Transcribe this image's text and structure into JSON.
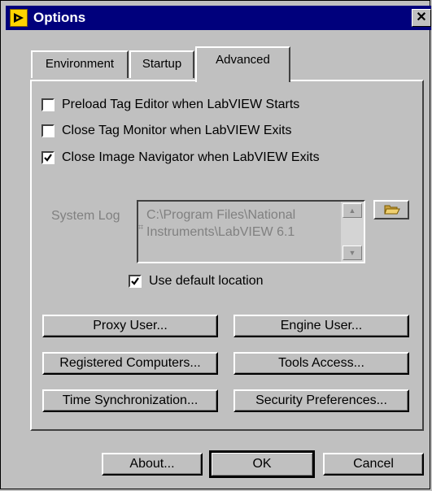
{
  "window": {
    "title": "Options",
    "close_glyph": "✕"
  },
  "tabs": [
    {
      "label": "Environment",
      "active": false
    },
    {
      "label": "Startup",
      "active": false
    },
    {
      "label": "Advanced",
      "active": true
    }
  ],
  "advanced": {
    "options": [
      {
        "label": "Preload Tag Editor when LabVIEW Starts",
        "checked": false
      },
      {
        "label": "Close Tag Monitor when LabVIEW Exits",
        "checked": false
      },
      {
        "label": "Close Image Navigator when LabVIEW Exits",
        "checked": true
      }
    ],
    "system_log": {
      "label": "System Log",
      "path_line1": "C:\\Program Files\\National",
      "path_line2": "Instruments\\LabVIEW 6.1",
      "enabled": false
    },
    "use_default_location": {
      "label": "Use default location",
      "checked": true
    },
    "buttons": {
      "proxy_user": "Proxy User...",
      "engine_user": "Engine User...",
      "registered_computers": "Registered Computers...",
      "tools_access": "Tools Access...",
      "time_sync": "Time Synchronization...",
      "security_prefs": "Security Preferences..."
    }
  },
  "footer": {
    "about": "About...",
    "ok": "OK",
    "cancel": "Cancel"
  },
  "colors": {
    "titlebar": "#00007c",
    "face": "#c0c0c0",
    "disabled_text": "#808080"
  },
  "icons": {
    "app": "labview-app-icon",
    "browse": "folder-open-icon"
  }
}
